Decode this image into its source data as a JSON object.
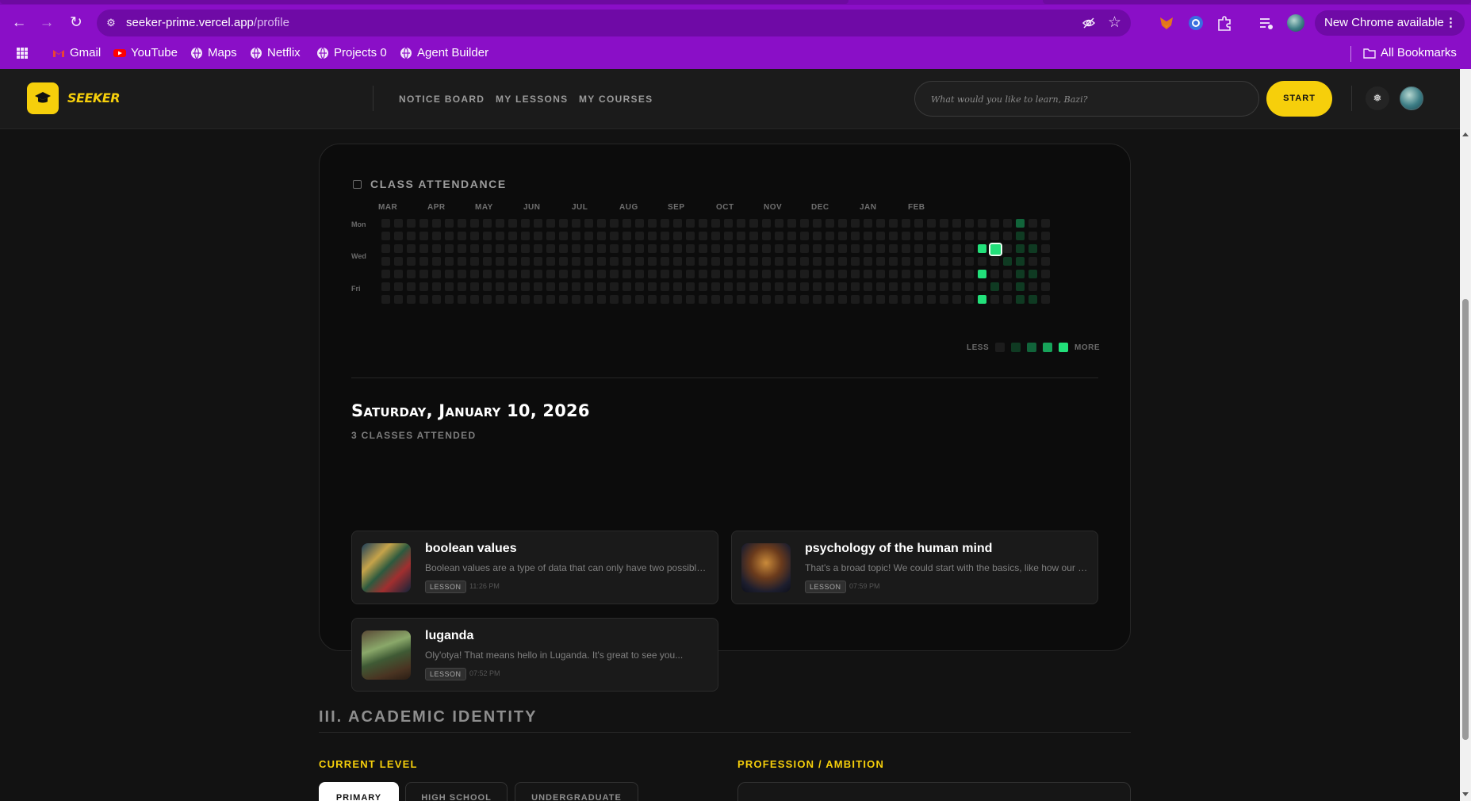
{
  "browser": {
    "url_host": "seeker-prime.vercel.app",
    "url_path": "/profile",
    "update_label": "New Chrome available",
    "bookmarks": [
      {
        "label": "Gmail",
        "icon": "gmail-icon"
      },
      {
        "label": "YouTube",
        "icon": "youtube-icon"
      },
      {
        "label": "Maps",
        "icon": "globe-icon"
      },
      {
        "label": "Netflix",
        "icon": "globe-icon"
      },
      {
        "label": "Projects 0",
        "icon": "globe-icon"
      },
      {
        "label": "Agent Builder",
        "icon": "globe-icon"
      }
    ],
    "all_bookmarks": "All Bookmarks",
    "accent": "#8a0fc7"
  },
  "header": {
    "logo_text": "SEEKER",
    "nav": [
      "NOTICE BOARD",
      "MY LESSONS",
      "MY COURSES"
    ],
    "search_placeholder": "What would you like to learn, Bazi?",
    "start_label": "START",
    "brand_color": "#f6cf0b"
  },
  "attendance": {
    "title": "CLASS ATTENDANCE",
    "months": [
      "MAR",
      "APR",
      "MAY",
      "JUN",
      "JUL",
      "AUG",
      "SEP",
      "OCT",
      "NOV",
      "DEC",
      "JAN",
      "FEB"
    ],
    "day_labels": [
      "Mon",
      "Wed",
      "Fri"
    ],
    "legend_less": "LESS",
    "legend_more": "MORE",
    "legend_colors": [
      "#1c1c1c",
      "#0f3a22",
      "#11643a",
      "#17a35a",
      "#22e07a"
    ],
    "active_cells": [
      {
        "week": 47,
        "day": 2,
        "level": 4
      },
      {
        "week": 48,
        "day": 2,
        "level": 4,
        "selected": true
      },
      {
        "week": 47,
        "day": 4,
        "level": 4
      },
      {
        "week": 47,
        "day": 6,
        "level": 4
      },
      {
        "week": 50,
        "day": 0,
        "level": 2
      },
      {
        "week": 50,
        "day": 1,
        "level": 1
      },
      {
        "week": 50,
        "day": 2,
        "level": 1
      },
      {
        "week": 51,
        "day": 2,
        "level": 1
      },
      {
        "week": 50,
        "day": 3,
        "level": 1
      },
      {
        "week": 51,
        "day": 4,
        "level": 1
      },
      {
        "week": 50,
        "day": 4,
        "level": 1
      },
      {
        "week": 50,
        "day": 5,
        "level": 1
      },
      {
        "week": 51,
        "day": 6,
        "level": 1
      },
      {
        "week": 50,
        "day": 6,
        "level": 1
      },
      {
        "week": 49,
        "day": 3,
        "level": 1
      },
      {
        "week": 48,
        "day": 5,
        "level": 1
      }
    ]
  },
  "day_detail": {
    "date": "Saturday, January 10, 2026",
    "subtitle": "3 CLASSES ATTENDED",
    "lessons": [
      {
        "title": "boolean values",
        "desc": "Boolean values are a type of data that can only have two possible values: true or false.",
        "tag": "LESSON",
        "time": "11:26 PM"
      },
      {
        "title": "psychology of the human mind",
        "desc": "That's a broad topic! We could start with the basics, like how our minds process information.",
        "tag": "LESSON",
        "time": "07:59 PM"
      },
      {
        "title": "luganda",
        "desc": "Oly'otya! That means hello in Luganda. It's great to see you...",
        "tag": "LESSON",
        "time": "07:52 PM"
      }
    ]
  },
  "identity": {
    "title": "III. ACADEMIC IDENTITY",
    "current_level_label": "CURRENT LEVEL",
    "levels": [
      "PRIMARY",
      "HIGH SCHOOL",
      "UNDERGRADUATE"
    ],
    "selected_level": "PRIMARY",
    "profession_label": "PROFESSION / AMBITION"
  }
}
